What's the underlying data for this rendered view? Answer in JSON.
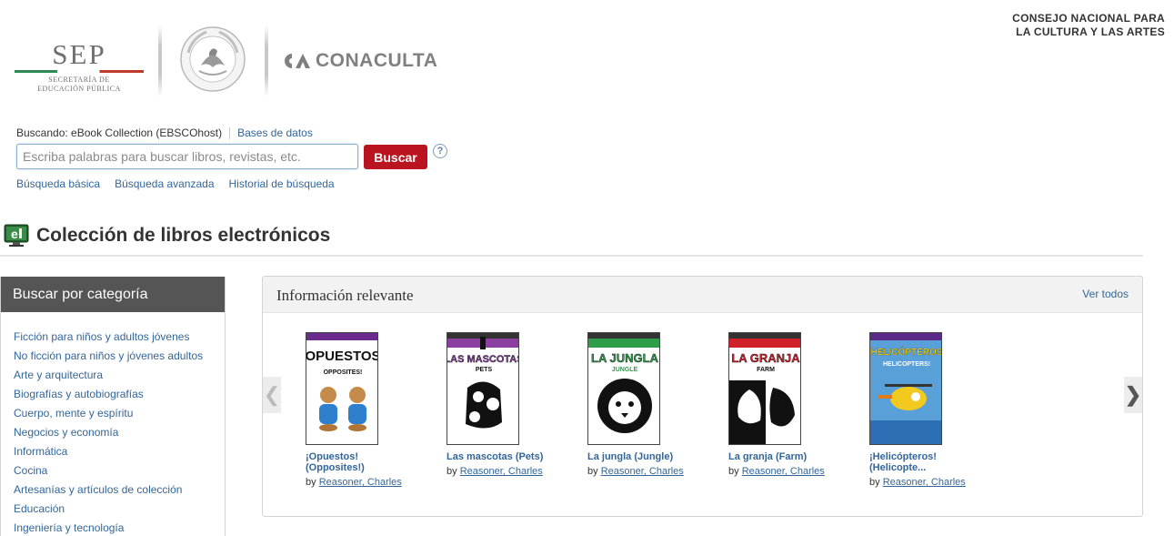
{
  "header": {
    "sep_logo": {
      "title": "SEP",
      "subtitle_line1": "SECRETARÍA DE",
      "subtitle_line2": "EDUCACIÓN PÚBLICA"
    },
    "seal_icon": "mexican-coat-of-arms-seal",
    "conaculta_logo": {
      "text": "CONACULTA"
    },
    "council_line1": "CONSEJO NACIONAL PARA",
    "council_line2": "LA CULTURA Y LAS ARTES"
  },
  "search": {
    "searching_label": "Buscando: eBook Collection (EBSCOhost)",
    "databases_link": "Bases de datos",
    "placeholder": "Escriba palabras para buscar libros, revistas, etc.",
    "value": "",
    "button_label": "Buscar",
    "help_icon": "?",
    "links": [
      "Búsqueda básica",
      "Búsqueda avanzada",
      "Historial de búsqueda"
    ]
  },
  "page": {
    "title": "Colección de libros electrónicos",
    "icon": "ebook-icon"
  },
  "sidebar": {
    "heading": "Buscar por categoría",
    "items": [
      "Ficción para niños y adultos jóvenes",
      "No ficción para niños y jóvenes adultos",
      "Arte y arquitectura",
      "Biografías y autobiografías",
      "Cuerpo, mente y espíritu",
      "Negocios y economía",
      "Informática",
      "Cocina",
      "Artesanías y artículos de colección",
      "Educación",
      "Ingeniería y tecnología"
    ]
  },
  "relevant": {
    "title": "Información relevante",
    "see_all": "Ver todos",
    "prev_arrow": "❮",
    "next_arrow": "❯",
    "by_label": "by",
    "books": [
      {
        "title_line1": "¡Opuestos!",
        "title_line2": "(Opposites!)",
        "author": "Reasoner, Charles",
        "cover_text": "¡OPUESTOS!",
        "cover_sub": "OPPOSITES!",
        "accent": "#6a2c8c"
      },
      {
        "title_line1": "Las mascotas (Pets)",
        "title_line2": "",
        "author": "Reasoner, Charles",
        "cover_text": "LAS MASCOTAS",
        "cover_sub": "PETS",
        "accent": "#8b3fa0"
      },
      {
        "title_line1": "La jungla (Jungle)",
        "title_line2": "",
        "author": "Reasoner, Charles",
        "cover_text": "LA JUNGLA",
        "cover_sub": "JUNGLE",
        "accent": "#2e9d4a"
      },
      {
        "title_line1": "La granja (Farm)",
        "title_line2": "",
        "author": "Reasoner, Charles",
        "cover_text": "LA GRANJA",
        "cover_sub": "FARM",
        "accent": "#d0202a"
      },
      {
        "title_line1": "¡Helicópteros!",
        "title_line2": "(Helicopte...",
        "author": "Reasoner, Charles",
        "cover_text": "¡HELICÓPTEROS!",
        "cover_sub": "HELICOPTERS!",
        "accent": "#5b2a86"
      }
    ]
  },
  "colors": {
    "brand_red": "#b9141f",
    "link_blue": "#336699",
    "sidebar_header": "#555555"
  }
}
